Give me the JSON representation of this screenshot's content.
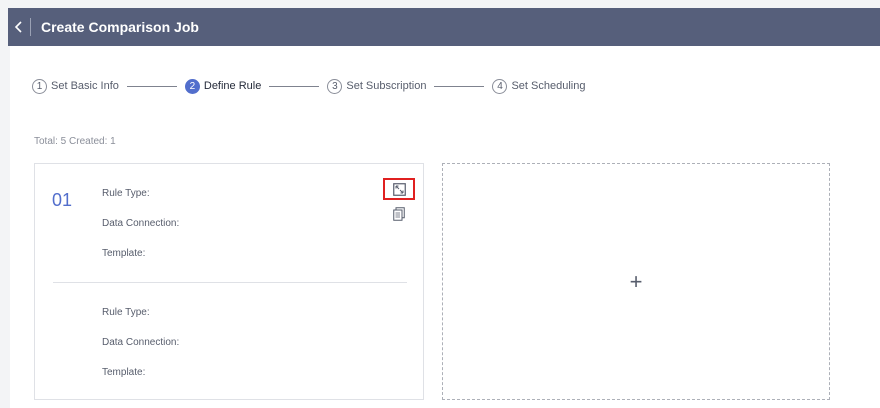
{
  "header": {
    "title": "Create Comparison Job",
    "back_icon": "chevron-left-icon"
  },
  "steps": [
    {
      "number": "1",
      "label": "Set Basic Info",
      "active": false
    },
    {
      "number": "2",
      "label": "Define Rule",
      "active": true
    },
    {
      "number": "3",
      "label": "Set Subscription",
      "active": false
    },
    {
      "number": "4",
      "label": "Set Scheduling",
      "active": false
    }
  ],
  "summary": "Total: 5 Created: 1",
  "rule_card": {
    "index": "01",
    "group1": {
      "rule_type_label": "Rule Type:",
      "data_connection_label": "Data Connection:",
      "template_label": "Template:"
    },
    "group2": {
      "rule_type_label": "Rule Type:",
      "data_connection_label": "Data Connection:",
      "template_label": "Template:"
    },
    "expand_icon": "expand-icon",
    "copy_icon": "copy-icon"
  },
  "add_card": {
    "icon": "plus-icon",
    "symbol": "+"
  },
  "colors": {
    "header_bg": "#565f7b",
    "accent": "#526ecc",
    "highlight_border": "#e02020"
  }
}
